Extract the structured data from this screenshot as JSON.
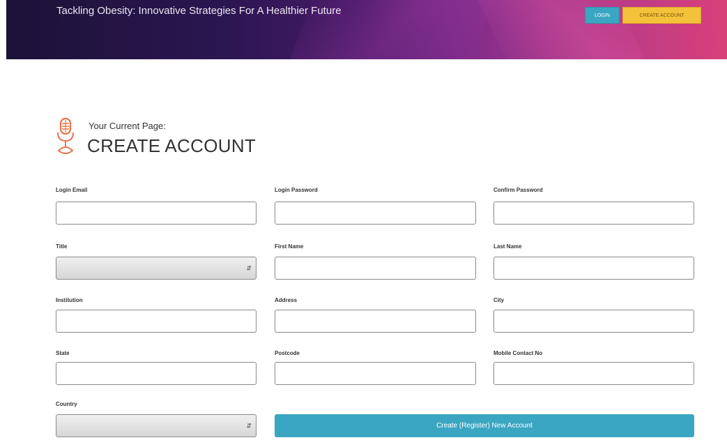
{
  "header": {
    "site_title": "Tackling Obesity: Innovative Strategies For A Healthier Future",
    "login_label": "LOGIN",
    "create_account_label": "CREATE ACCOUNT"
  },
  "page": {
    "current_label": "Your Current Page:",
    "title": "CREATE ACCOUNT"
  },
  "form": {
    "login_email": {
      "label": "Login Email",
      "value": ""
    },
    "login_password": {
      "label": "Login Password",
      "value": ""
    },
    "confirm_password": {
      "label": "Confirm Password",
      "value": ""
    },
    "title": {
      "label": "Title",
      "value": ""
    },
    "first_name": {
      "label": "First Name",
      "value": ""
    },
    "last_name": {
      "label": "Last Name",
      "value": ""
    },
    "institution": {
      "label": "Institution",
      "value": ""
    },
    "address": {
      "label": "Address",
      "value": ""
    },
    "city": {
      "label": "City",
      "value": ""
    },
    "state": {
      "label": "State",
      "value": ""
    },
    "postcode": {
      "label": "Postcode",
      "value": ""
    },
    "mobile": {
      "label": "Mobile Contact No",
      "value": ""
    },
    "country": {
      "label": "Country",
      "value": ""
    },
    "submit_label": "Create (Register) New Account"
  },
  "colors": {
    "accent": "#3ba6c2",
    "create_button": "#f3c23a",
    "icon": "#e8734a"
  },
  "icons": {
    "page_icon": "microphone-icon",
    "select_arrow": "up-down-arrows-icon"
  }
}
